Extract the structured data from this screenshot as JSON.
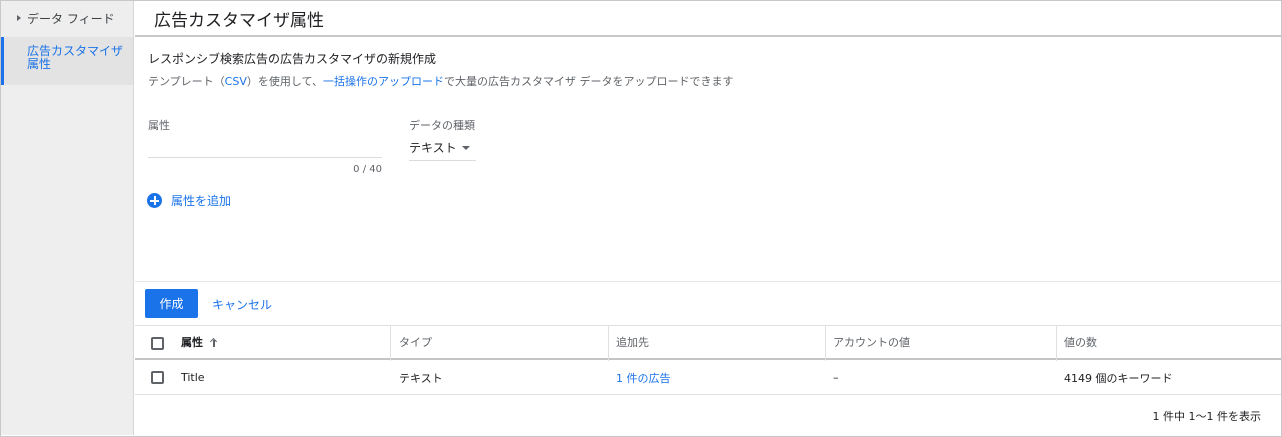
{
  "sidebar": {
    "parent_label": "データ フィード",
    "active_label_line1": "広告カスタマイザ",
    "active_label_line2": "属性"
  },
  "header": {
    "title": "広告カスタマイザ属性"
  },
  "form": {
    "heading": "レスポンシブ検索広告の広告カスタマイザの新規作成",
    "sub_part1": "テンプレート（",
    "sub_csv": "CSV",
    "sub_part2": "）を使用して、",
    "sub_link": "一括操作のアップロード",
    "sub_part3": "で大量の広告カスタマイザ データをアップロードできます",
    "attribute_label": "属性",
    "attribute_value": "",
    "attribute_counter": "0 / 40",
    "data_type_label": "データの種類",
    "data_type_value": "テキスト",
    "add_attribute_label": "属性を追加",
    "create_button": "作成",
    "cancel_button": "キャンセル"
  },
  "table": {
    "columns": [
      "属性",
      "タイプ",
      "追加先",
      "アカウントの値",
      "値の数"
    ],
    "rows": [
      {
        "attribute": "Title",
        "type": "テキスト",
        "added_to": "1 件の広告",
        "account_value": "–",
        "value_count": "4149 個のキーワード"
      }
    ],
    "pagination": "1 件中 1～1 件を表示"
  },
  "colors": {
    "accent": "#1a73e8",
    "sidebar_bg": "#eeeeee"
  },
  "icons": [
    "triangle-right-icon",
    "add-circle-icon",
    "sort-ascending-icon",
    "checkbox-icon",
    "dropdown-caret-icon"
  ]
}
